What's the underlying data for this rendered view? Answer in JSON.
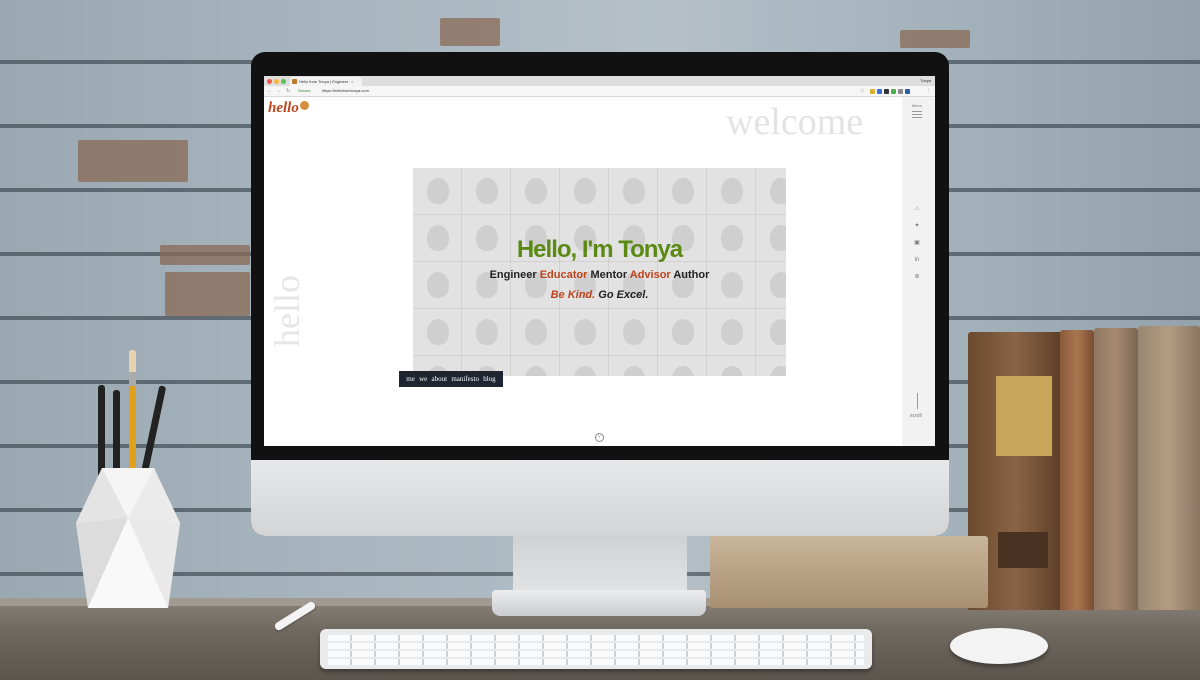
{
  "browser": {
    "tab_title": "Hello from Tonya | Engineer",
    "tab_close": "×",
    "profile": "Tonya",
    "secure_label": "Secure",
    "url": "https://hellofromtonya.com",
    "nav_back": "←",
    "nav_forward": "→",
    "nav_reload": "↻",
    "bookmark_icon": "☆"
  },
  "site": {
    "logo": "hello",
    "welcome": "welcome",
    "side_word": "hello",
    "menu_label": "Menu",
    "scroll_label": "scroll",
    "hero": {
      "title": "Hello, I'm Tonya",
      "roles": [
        "Engineer",
        "Educator",
        "Mentor",
        "Advisor",
        "Author"
      ],
      "tag_a": "Be Kind.",
      "tag_b": "Go Excel."
    },
    "nav": [
      "me",
      "we",
      "about",
      "manifesto",
      "blog"
    ],
    "social_icons": [
      "home-icon",
      "twitter-icon",
      "github-icon",
      "linkedin-icon",
      "wordpress-icon"
    ],
    "down_arrow": "˅"
  },
  "colors": {
    "accent_orange": "#c0441c",
    "accent_green": "#5b8a14",
    "nav_bg": "#1e2430"
  }
}
